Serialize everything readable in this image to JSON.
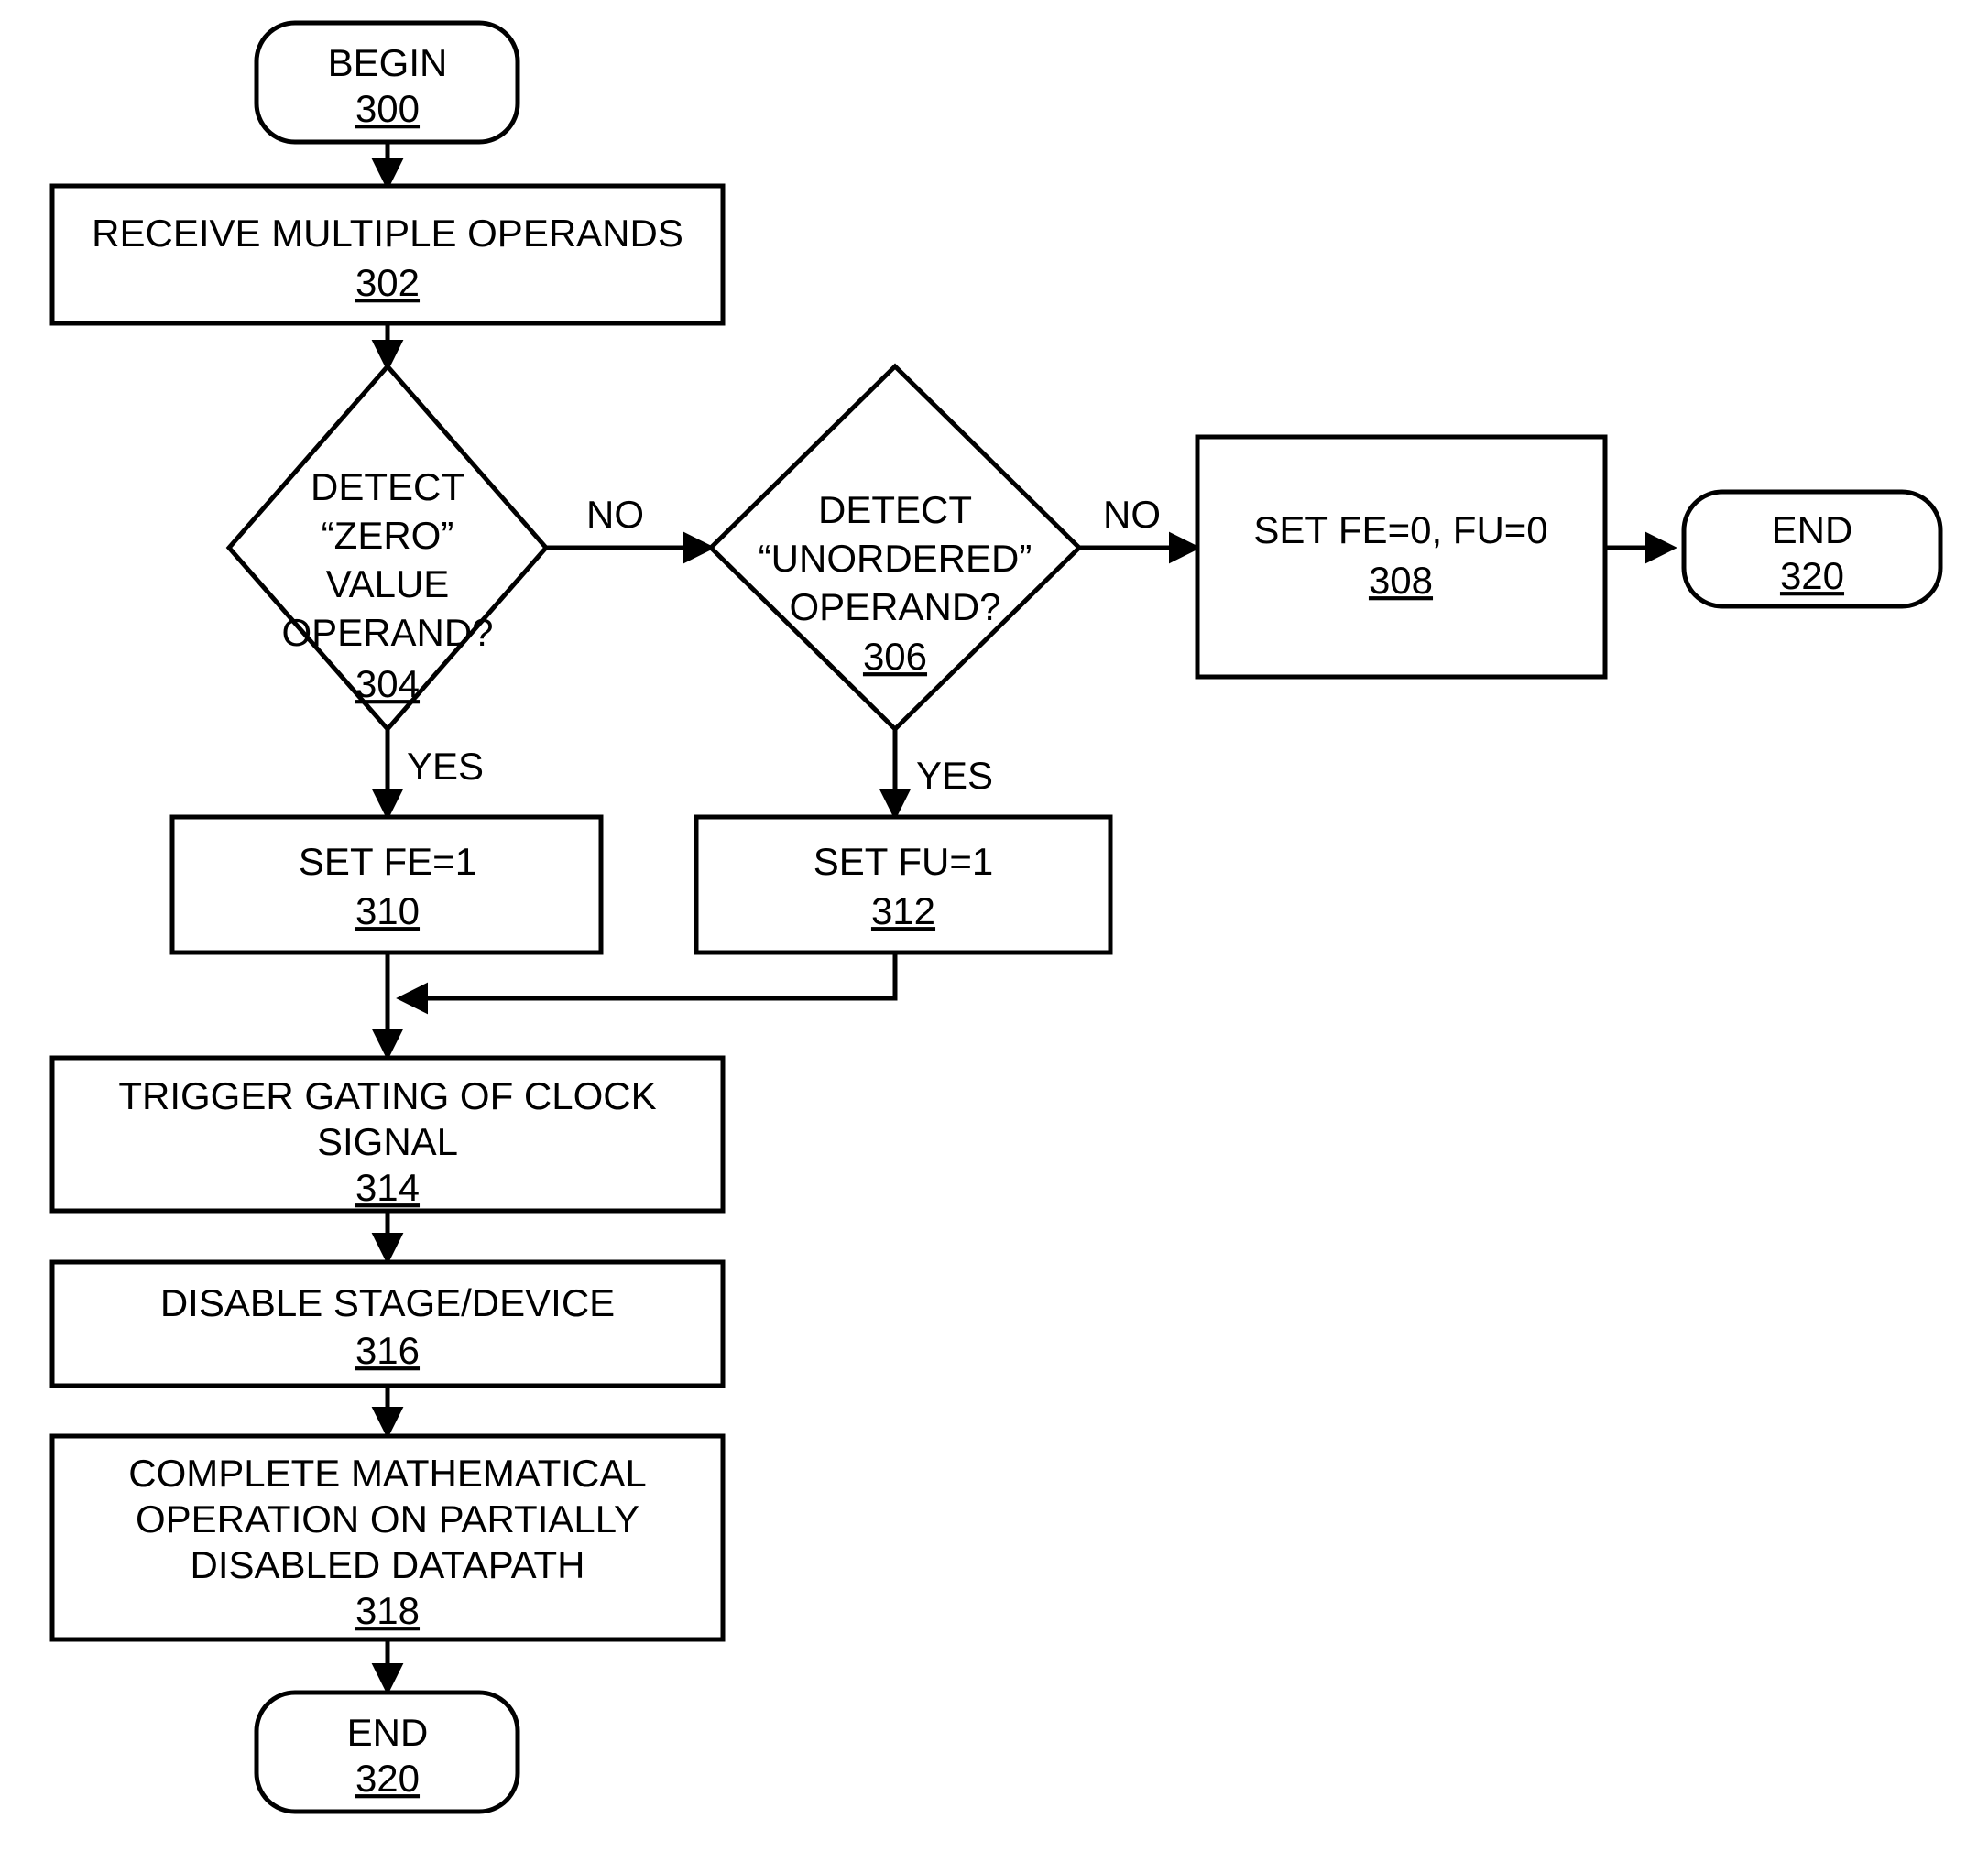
{
  "figure": {
    "type": "flowchart",
    "orientation": "top-down-with-right-branch",
    "background_color": "#ffffff",
    "line_color": "#000000"
  },
  "nodes": {
    "begin_300": {
      "shape": "rounded-rectangle",
      "lines": [
        "BEGIN"
      ],
      "ref": "300"
    },
    "receive_302": {
      "shape": "rectangle",
      "lines": [
        "RECEIVE MULTIPLE OPERANDS"
      ],
      "ref": "302"
    },
    "detect_zero_304": {
      "shape": "diamond",
      "lines": [
        "DETECT",
        "“ZERO”",
        "VALUE",
        "OPERAND?"
      ],
      "ref": "304"
    },
    "detect_unordered_306": {
      "shape": "diamond",
      "lines": [
        "DETECT",
        "“UNORDERED”",
        "OPERAND?"
      ],
      "ref": "306"
    },
    "set_fe0_fu0_308": {
      "shape": "rectangle",
      "lines": [
        "SET FE=0, FU=0"
      ],
      "ref": "308"
    },
    "end_320_right": {
      "shape": "rounded-rectangle",
      "lines": [
        "END"
      ],
      "ref": "320"
    },
    "set_fe1_310": {
      "shape": "rectangle",
      "lines": [
        "SET FE=1"
      ],
      "ref": "310"
    },
    "set_fu1_312": {
      "shape": "rectangle",
      "lines": [
        "SET FU=1"
      ],
      "ref": "312"
    },
    "trigger_gating_314": {
      "shape": "rectangle",
      "lines": [
        "TRIGGER GATING OF CLOCK",
        "SIGNAL"
      ],
      "ref": "314"
    },
    "disable_stage_316": {
      "shape": "rectangle",
      "lines": [
        "DISABLE STAGE/DEVICE"
      ],
      "ref": "316"
    },
    "complete_math_318": {
      "shape": "rectangle",
      "lines": [
        "COMPLETE MATHEMATICAL",
        "OPERATION ON PARTIALLY",
        "DISABLED DATAPATH"
      ],
      "ref": "318"
    },
    "end_320_bottom": {
      "shape": "rounded-rectangle",
      "lines": [
        "END"
      ],
      "ref": "320"
    }
  },
  "edge_labels": {
    "zero_no": "NO",
    "zero_yes": "YES",
    "unordered_no": "NO",
    "unordered_yes": "YES"
  }
}
